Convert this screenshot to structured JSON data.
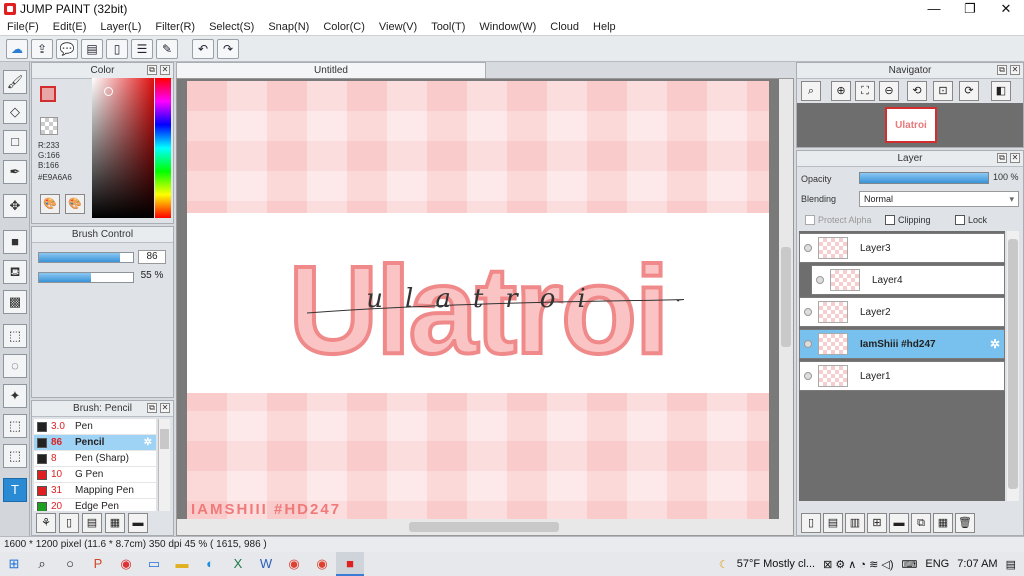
{
  "window": {
    "title": "JUMP PAINT (32bit)",
    "minimize": "—",
    "maximize": "❐",
    "close": "✕"
  },
  "menu": [
    "File(F)",
    "Edit(E)",
    "Layer(L)",
    "Filter(R)",
    "Select(S)",
    "Snap(N)",
    "Color(C)",
    "View(V)",
    "Tool(T)",
    "Window(W)",
    "Cloud",
    "Help"
  ],
  "toolbar_icons": [
    "cloud-icon",
    "share-icon",
    "comment-icon",
    "chat-icon",
    "page-icon",
    "list-icon",
    "edit-icon",
    "undo-icon",
    "redo-icon"
  ],
  "tools": [
    "brush-icon",
    "eraser-icon",
    "rectangle-icon",
    "pen-tool-icon",
    "move-icon",
    "fill-rect-icon",
    "bucket-icon",
    "gradient-icon",
    "rect-select-icon",
    "lasso-icon",
    "magic-wand-icon",
    "select-pen-icon",
    "select-eraser-icon",
    "text-icon"
  ],
  "color_panel": {
    "title": "Color",
    "r": "R:233",
    "g": "G:166",
    "b": "B:166",
    "hex": "#E9A6A6",
    "main_color": "#e9a6a6"
  },
  "brush_control": {
    "title": "Brush Control",
    "size_value": "86",
    "size_fraction": 0.86,
    "opacity_value": "55 %",
    "opacity_fraction": 0.55
  },
  "brush_panel": {
    "title": "Brush: Pencil",
    "brushes": [
      {
        "size": "3.0",
        "name": "Pen",
        "color": "#222222"
      },
      {
        "size": "86",
        "name": "Pencil",
        "color": "#222222"
      },
      {
        "size": "8",
        "name": "Pen (Sharp)",
        "color": "#222222"
      },
      {
        "size": "10",
        "name": "G Pen",
        "color": "#e02020"
      },
      {
        "size": "31",
        "name": "Mapping Pen",
        "color": "#e02020"
      },
      {
        "size": "20",
        "name": "Edge Pen",
        "color": "#20a020"
      }
    ]
  },
  "document": {
    "tab": "Untitled",
    "art_title": "Ulatroi",
    "art_script": "ulatroi",
    "watermark": "IAMSHIII #HD247"
  },
  "navigator": {
    "title": "Navigator",
    "thumb_text": "Ulatroi"
  },
  "layer_panel": {
    "title": "Layer",
    "opacity_label": "Opacity",
    "opacity_value": "100 %",
    "blending_label": "Blending",
    "blending_value": "Normal",
    "protect_alpha": "Protect Alpha",
    "clipping": "Clipping",
    "lock": "Lock",
    "layers": [
      {
        "name": "Layer3"
      },
      {
        "name": "Layer4"
      },
      {
        "name": "Layer2"
      },
      {
        "name": "IamShiii #hd247"
      },
      {
        "name": "Layer1"
      }
    ]
  },
  "status": {
    "text": "1600 * 1200 pixel  (11.6 * 8.7cm)  350 dpi  45 %  ( 1615, 986 )"
  },
  "taskbar": {
    "weather": "57°F  Mostly cl...",
    "lang": "ENG",
    "time": "7:07 AM"
  }
}
